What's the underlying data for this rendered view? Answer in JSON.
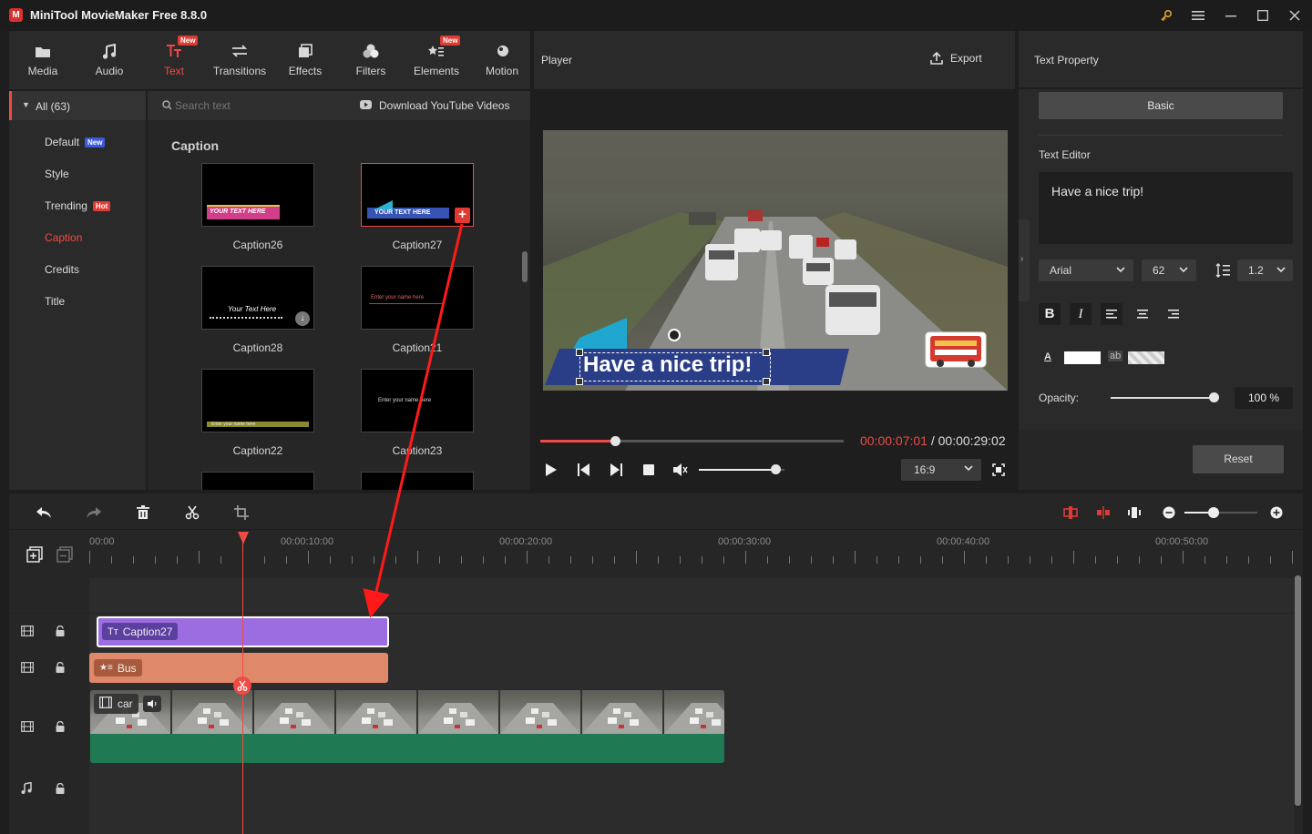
{
  "app": {
    "title": "MiniTool MovieMaker Free 8.8.0"
  },
  "toolbar": {
    "items": [
      {
        "label": "Media",
        "icon": "folder-icon"
      },
      {
        "label": "Audio",
        "icon": "music-note-icon"
      },
      {
        "label": "Text",
        "icon": "text-icon",
        "badge": "New",
        "active": true
      },
      {
        "label": "Transitions",
        "icon": "transitions-icon"
      },
      {
        "label": "Effects",
        "icon": "effects-icon"
      },
      {
        "label": "Filters",
        "icon": "filters-icon"
      },
      {
        "label": "Elements",
        "icon": "elements-icon",
        "badge": "New"
      },
      {
        "label": "Motion",
        "icon": "motion-icon"
      }
    ]
  },
  "categories": {
    "all_label": "All (63)",
    "items": [
      {
        "label": "Default",
        "badge": "New"
      },
      {
        "label": "Style"
      },
      {
        "label": "Trending",
        "badge": "Hot"
      },
      {
        "label": "Caption",
        "active": true
      },
      {
        "label": "Credits"
      },
      {
        "label": "Title"
      }
    ]
  },
  "library": {
    "search_placeholder": "Search text",
    "youtube_label": "Download YouTube Videos",
    "section_title": "Caption",
    "thumbs": [
      {
        "name": "Caption26",
        "overlay": "YOUR TEXT HERE"
      },
      {
        "name": "Caption27",
        "overlay": "YOUR TEXT HERE"
      },
      {
        "name": "Caption28",
        "overlay": "Your Text Here"
      },
      {
        "name": "Caption21",
        "overlay": "Enter your name here"
      },
      {
        "name": "Caption22",
        "overlay": "Enter your name here"
      },
      {
        "name": "Caption23",
        "overlay": "Enter your name here"
      }
    ]
  },
  "player": {
    "title": "Player",
    "export_label": "Export",
    "caption_text": "Have a nice trip!",
    "current_time": "00:00:07:01",
    "separator": " / ",
    "total_time": "00:00:29:02",
    "aspect": "16:9",
    "progress_fraction": 0.25,
    "volume_fraction": 0.9
  },
  "properties": {
    "title": "Text Property",
    "tab_basic": "Basic",
    "editor_label": "Text Editor",
    "editor_text": "Have a nice trip!",
    "font": "Arial",
    "size": "62",
    "line_spacing": "1.2",
    "color_label": "A",
    "bg_label": "ab",
    "opacity_label": "Opacity:",
    "opacity_value": "100 %",
    "opacity_fraction": 1.0,
    "reset_label": "Reset"
  },
  "timeline": {
    "ruler": [
      "00:00",
      "00:00:10:00",
      "00:00:20:00",
      "00:00:30:00",
      "00:00:40:00",
      "00:00:50:00"
    ],
    "clips": {
      "caption": "Caption27",
      "element": "Bus",
      "video": "car"
    },
    "zoom_fraction": 0.4
  },
  "colors": {
    "accent": "#ef4b45",
    "caption_clip": "#9b6de0",
    "element_clip": "#e0896a",
    "audio_band": "#1f7a53"
  }
}
